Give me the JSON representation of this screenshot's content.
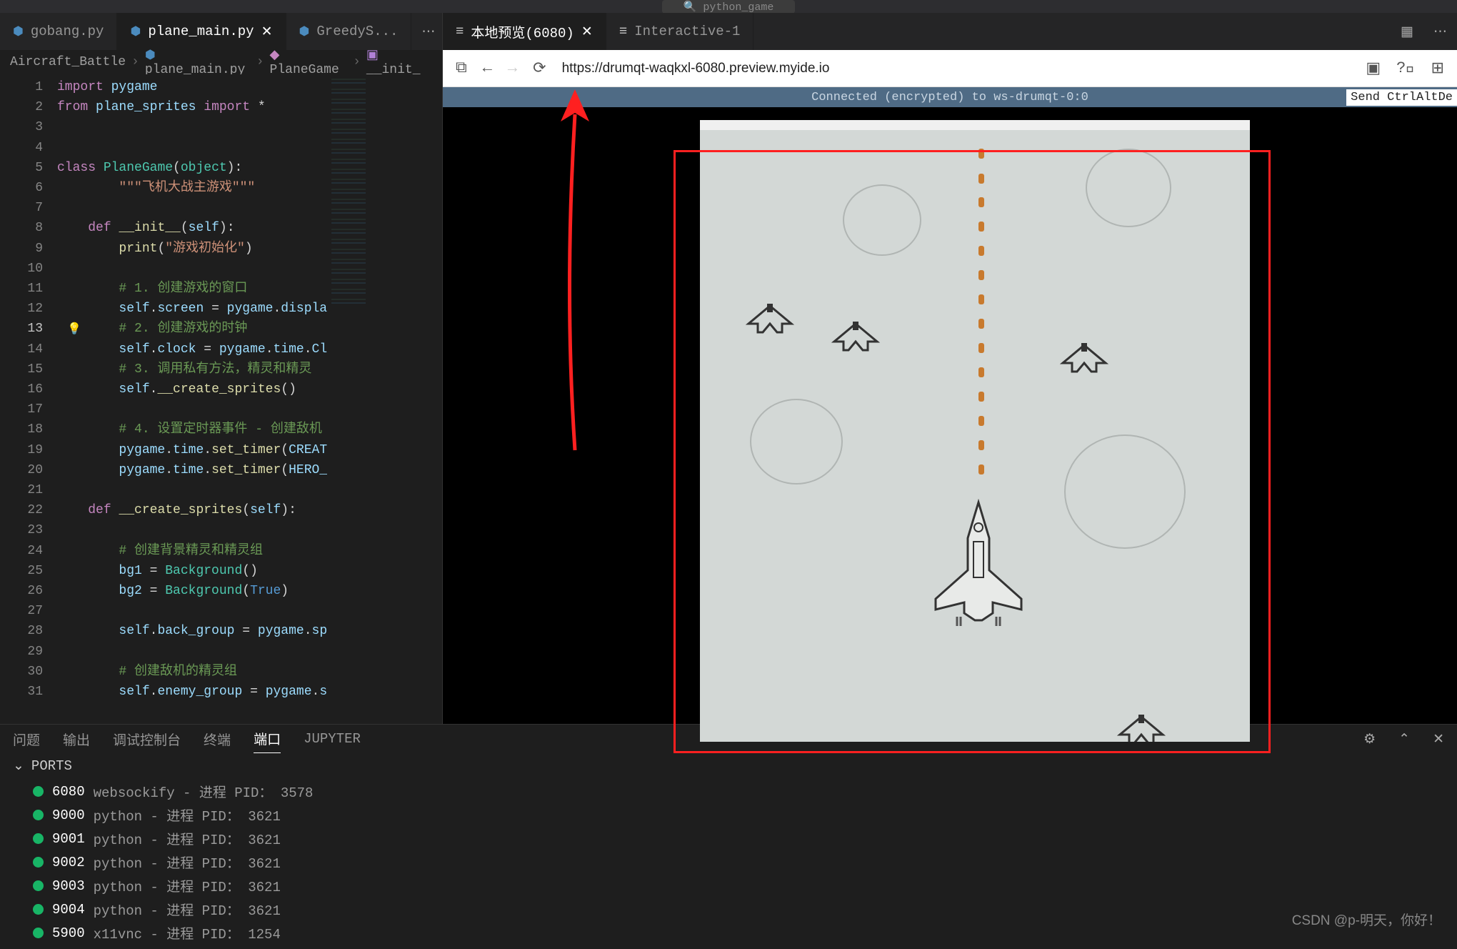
{
  "topbar": {
    "title": "python_game"
  },
  "left_tabs": [
    {
      "label": "gobang.py",
      "icon": "python"
    },
    {
      "label": "plane_main.py",
      "icon": "python",
      "active": true,
      "closable": true
    },
    {
      "label": "GreedyS...",
      "icon": "python"
    }
  ],
  "right_tabs": [
    {
      "label": "本地预览(6080)",
      "icon": "list",
      "active": true,
      "closable": true
    },
    {
      "label": "Interactive-1",
      "icon": "list"
    }
  ],
  "breadcrumb": {
    "items": [
      "Aircraft_Battle",
      "plane_main.py",
      "PlaneGame",
      "__init_"
    ]
  },
  "browser": {
    "url": "https://drumqt-waqkxl-6080.preview.myide.io",
    "conn": "Connected (encrypted) to ws-drumqt-0:0",
    "send": "Send CtrlAltDe"
  },
  "code_lines": [
    {
      "n": 1,
      "seg": [
        [
          "kw",
          "import"
        ],
        [
          "op",
          " "
        ],
        [
          "prop",
          "pygame"
        ]
      ]
    },
    {
      "n": 2,
      "seg": [
        [
          "kw",
          "from"
        ],
        [
          "op",
          " "
        ],
        [
          "prop",
          "plane_sprites"
        ],
        [
          "op",
          " "
        ],
        [
          "kw",
          "import"
        ],
        [
          "op",
          " *"
        ]
      ]
    },
    {
      "n": 3,
      "seg": []
    },
    {
      "n": 4,
      "seg": []
    },
    {
      "n": 5,
      "seg": [
        [
          "kw",
          "class"
        ],
        [
          "op",
          " "
        ],
        [
          "cls",
          "PlaneGame"
        ],
        [
          "op",
          "("
        ],
        [
          "cls",
          "object"
        ],
        [
          "op",
          "):"
        ]
      ]
    },
    {
      "n": 6,
      "seg": [
        [
          "op",
          "        "
        ],
        [
          "str",
          "\"\"\"飞机大战主游戏\"\"\""
        ]
      ]
    },
    {
      "n": 7,
      "seg": []
    },
    {
      "n": 8,
      "seg": [
        [
          "op",
          "    "
        ],
        [
          "kw",
          "def"
        ],
        [
          "op",
          " "
        ],
        [
          "fn",
          "__init__"
        ],
        [
          "op",
          "("
        ],
        [
          "self",
          "self"
        ],
        [
          "op",
          "):"
        ]
      ]
    },
    {
      "n": 9,
      "seg": [
        [
          "op",
          "        "
        ],
        [
          "fn",
          "print"
        ],
        [
          "op",
          "("
        ],
        [
          "str",
          "\"游戏初始化\""
        ],
        [
          "op",
          ")"
        ]
      ]
    },
    {
      "n": 10,
      "seg": []
    },
    {
      "n": 11,
      "seg": [
        [
          "op",
          "        "
        ],
        [
          "cmt",
          "# 1. 创建游戏的窗口"
        ]
      ]
    },
    {
      "n": 12,
      "seg": [
        [
          "op",
          "        "
        ],
        [
          "self",
          "self"
        ],
        [
          "op",
          "."
        ],
        [
          "prop",
          "screen"
        ],
        [
          "op",
          " = "
        ],
        [
          "prop",
          "pygame"
        ],
        [
          "op",
          "."
        ],
        [
          "prop",
          "displa"
        ]
      ]
    },
    {
      "n": 13,
      "seg": [
        [
          "op",
          "        "
        ],
        [
          "cmt",
          "# 2. 创建游戏的时钟"
        ]
      ],
      "current": true
    },
    {
      "n": 14,
      "seg": [
        [
          "op",
          "        "
        ],
        [
          "self",
          "self"
        ],
        [
          "op",
          "."
        ],
        [
          "prop",
          "clock"
        ],
        [
          "op",
          " = "
        ],
        [
          "prop",
          "pygame"
        ],
        [
          "op",
          "."
        ],
        [
          "prop",
          "time"
        ],
        [
          "op",
          "."
        ],
        [
          "prop",
          "Cl"
        ]
      ]
    },
    {
      "n": 15,
      "seg": [
        [
          "op",
          "        "
        ],
        [
          "cmt",
          "# 3. 调用私有方法，精灵和精灵"
        ]
      ]
    },
    {
      "n": 16,
      "seg": [
        [
          "op",
          "        "
        ],
        [
          "self",
          "self"
        ],
        [
          "op",
          "."
        ],
        [
          "fn",
          "__create_sprites"
        ],
        [
          "op",
          "()"
        ]
      ]
    },
    {
      "n": 17,
      "seg": []
    },
    {
      "n": 18,
      "seg": [
        [
          "op",
          "        "
        ],
        [
          "cmt",
          "# 4. 设置定时器事件 - 创建敌机"
        ]
      ]
    },
    {
      "n": 19,
      "seg": [
        [
          "op",
          "        "
        ],
        [
          "prop",
          "pygame"
        ],
        [
          "op",
          "."
        ],
        [
          "prop",
          "time"
        ],
        [
          "op",
          "."
        ],
        [
          "fn",
          "set_timer"
        ],
        [
          "op",
          "("
        ],
        [
          "prop",
          "CREAT"
        ]
      ]
    },
    {
      "n": 20,
      "seg": [
        [
          "op",
          "        "
        ],
        [
          "prop",
          "pygame"
        ],
        [
          "op",
          "."
        ],
        [
          "prop",
          "time"
        ],
        [
          "op",
          "."
        ],
        [
          "fn",
          "set_timer"
        ],
        [
          "op",
          "("
        ],
        [
          "prop",
          "HERO_"
        ]
      ]
    },
    {
      "n": 21,
      "seg": []
    },
    {
      "n": 22,
      "seg": [
        [
          "op",
          "    "
        ],
        [
          "kw",
          "def"
        ],
        [
          "op",
          " "
        ],
        [
          "fn",
          "__create_sprites"
        ],
        [
          "op",
          "("
        ],
        [
          "self",
          "self"
        ],
        [
          "op",
          "):"
        ]
      ]
    },
    {
      "n": 23,
      "seg": []
    },
    {
      "n": 24,
      "seg": [
        [
          "op",
          "        "
        ],
        [
          "cmt",
          "# 创建背景精灵和精灵组"
        ]
      ]
    },
    {
      "n": 25,
      "seg": [
        [
          "op",
          "        "
        ],
        [
          "prop",
          "bg1"
        ],
        [
          "op",
          " = "
        ],
        [
          "cls",
          "Background"
        ],
        [
          "op",
          "()"
        ]
      ]
    },
    {
      "n": 26,
      "seg": [
        [
          "op",
          "        "
        ],
        [
          "prop",
          "bg2"
        ],
        [
          "op",
          " = "
        ],
        [
          "cls",
          "Background"
        ],
        [
          "op",
          "("
        ],
        [
          "builtin",
          "True"
        ],
        [
          "op",
          ")"
        ]
      ]
    },
    {
      "n": 27,
      "seg": []
    },
    {
      "n": 28,
      "seg": [
        [
          "op",
          "        "
        ],
        [
          "self",
          "self"
        ],
        [
          "op",
          "."
        ],
        [
          "prop",
          "back_group"
        ],
        [
          "op",
          " = "
        ],
        [
          "prop",
          "pygame"
        ],
        [
          "op",
          "."
        ],
        [
          "prop",
          "sp"
        ]
      ]
    },
    {
      "n": 29,
      "seg": []
    },
    {
      "n": 30,
      "seg": [
        [
          "op",
          "        "
        ],
        [
          "cmt",
          "# 创建敌机的精灵组"
        ]
      ]
    },
    {
      "n": 31,
      "seg": [
        [
          "op",
          "        "
        ],
        [
          "self",
          "self"
        ],
        [
          "op",
          "."
        ],
        [
          "prop",
          "enemy_group"
        ],
        [
          "op",
          " = "
        ],
        [
          "prop",
          "pygame"
        ],
        [
          "op",
          "."
        ],
        [
          "prop",
          "s"
        ]
      ]
    }
  ],
  "panel_tabs": [
    "问题",
    "输出",
    "调试控制台",
    "终端",
    "端口",
    "JUPYTER"
  ],
  "panel_active": 4,
  "ports_title": "PORTS",
  "ports": [
    {
      "port": "6080",
      "desc": "websockify - 进程 PID： 3578"
    },
    {
      "port": "9000",
      "desc": "python - 进程 PID： 3621"
    },
    {
      "port": "9001",
      "desc": "python - 进程 PID： 3621"
    },
    {
      "port": "9002",
      "desc": "python - 进程 PID： 3621"
    },
    {
      "port": "9003",
      "desc": "python - 进程 PID： 3621"
    },
    {
      "port": "9004",
      "desc": "python - 进程 PID： 3621"
    },
    {
      "port": "5900",
      "desc": "x11vnc - 进程 PID： 1254"
    }
  ],
  "watermark": "CSDN @p-明天，你好！"
}
